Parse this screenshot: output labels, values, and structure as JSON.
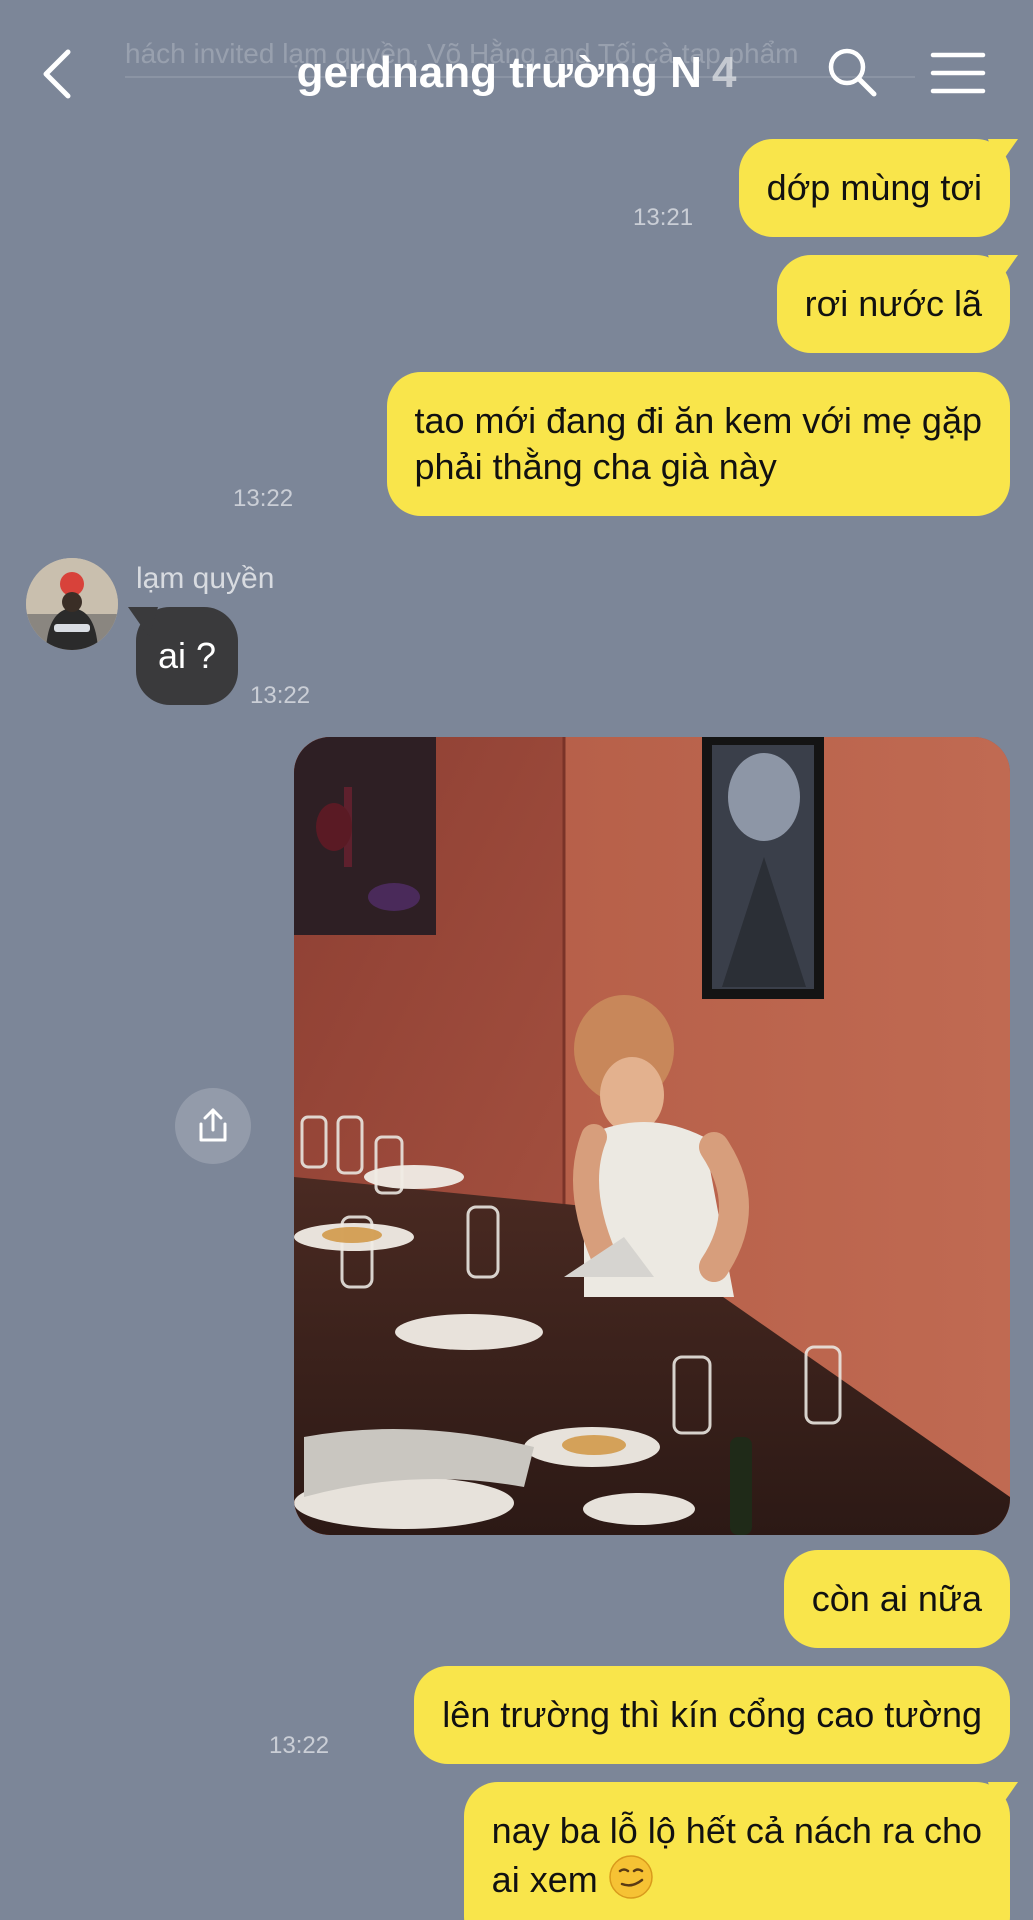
{
  "header": {
    "ghost_text": "hách invited lạm quyền, Võ Hằng and Tối cà tạp phẩm",
    "title": "gerdnang trường N",
    "member_count": "4"
  },
  "messages": [
    {
      "text": "dớp mùng tơi",
      "time": "13:21"
    },
    {
      "text": "rơi nước lã"
    },
    {
      "line1": "tao mới đang đi ăn kem với mẹ gặp",
      "line2": "phải thằng cha già này",
      "time": "13:22"
    }
  ],
  "incoming": {
    "sender": "lạm quyền",
    "text": "ai ?",
    "time": "13:22"
  },
  "messages_after": [
    {
      "text": "còn ai nữa"
    },
    {
      "text": "lên trường thì kín cổng cao tường",
      "time": "13:22"
    },
    {
      "line1": "nay ba lỗ lộ hết cả nách ra cho",
      "line2": "ai xem"
    }
  ],
  "colors": {
    "background": "#7c8698",
    "outgoing_bubble": "#f9e54b",
    "incoming_bubble": "#3a3a3c"
  },
  "icons": [
    "back-chevron-icon",
    "search-icon",
    "hamburger-menu-icon",
    "share-icon",
    "smirk-emoji-icon"
  ]
}
